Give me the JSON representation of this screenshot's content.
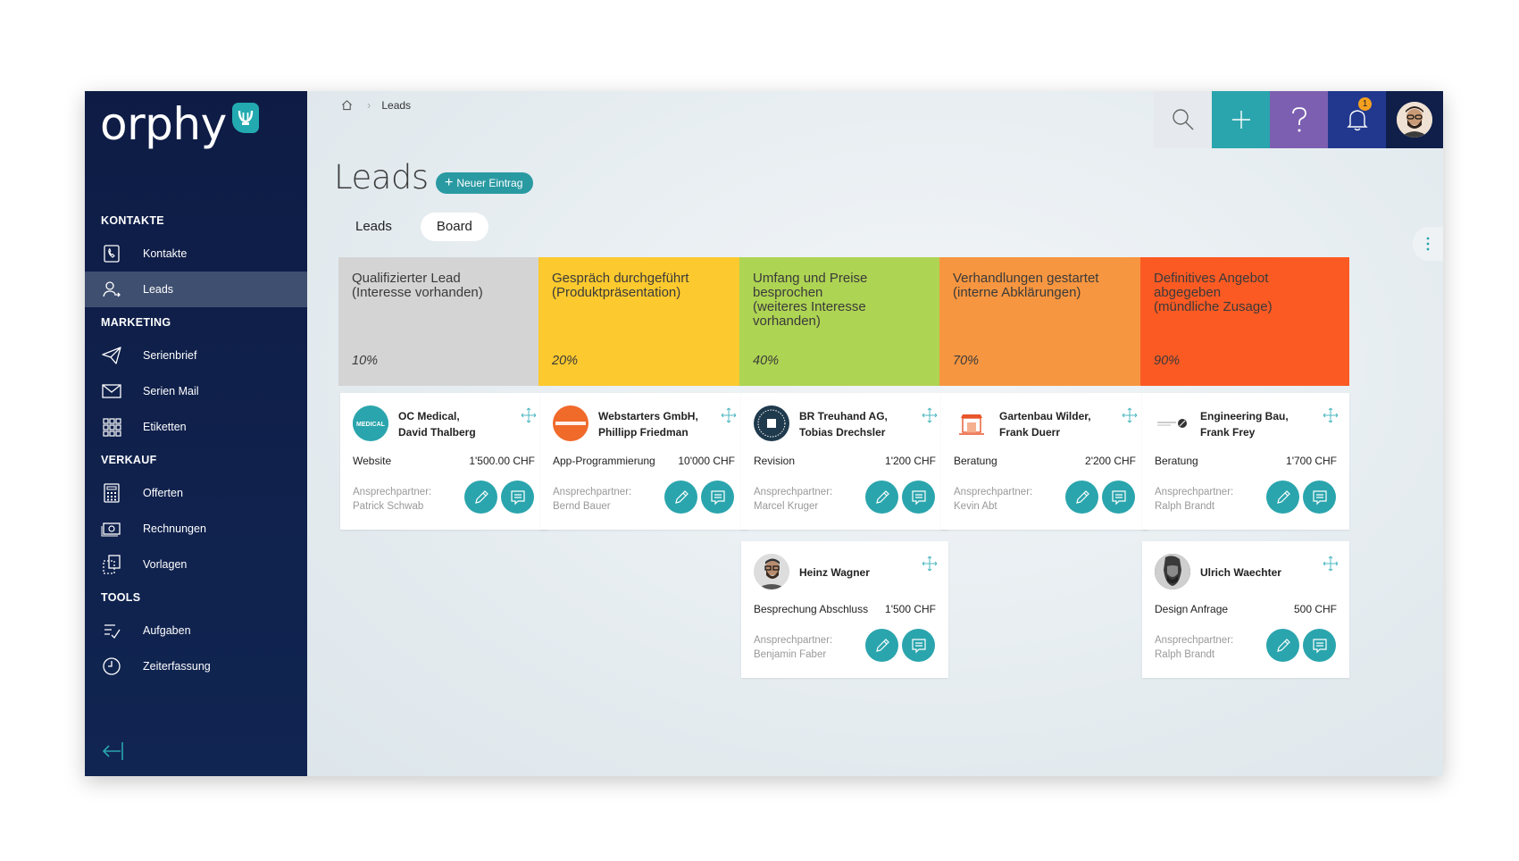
{
  "app": {
    "logo_text": "orphy"
  },
  "sidebar": {
    "sections": [
      {
        "label": "KONTAKTE",
        "items": [
          {
            "label": "Kontakte",
            "icon": "phone-book-icon",
            "active": false
          },
          {
            "label": "Leads",
            "icon": "user-lead-icon",
            "active": true
          }
        ]
      },
      {
        "label": "MARKETING",
        "items": [
          {
            "label": "Serienbrief",
            "icon": "paper-plane-icon",
            "active": false
          },
          {
            "label": "Serien Mail",
            "icon": "envelope-icon",
            "active": false
          },
          {
            "label": "Etiketten",
            "icon": "grid-labels-icon",
            "active": false
          }
        ]
      },
      {
        "label": "VERKAUF",
        "items": [
          {
            "label": "Offerten",
            "icon": "calculator-icon",
            "active": false
          },
          {
            "label": "Rechnungen",
            "icon": "banknote-icon",
            "active": false
          },
          {
            "label": "Vorlagen",
            "icon": "templates-icon",
            "active": false
          }
        ]
      },
      {
        "label": "TOOLS",
        "items": [
          {
            "label": "Aufgaben",
            "icon": "task-check-icon",
            "active": false
          },
          {
            "label": "Zeiterfassung",
            "icon": "clock-icon",
            "active": false
          }
        ]
      }
    ]
  },
  "breadcrumb": {
    "home_icon": "home-icon",
    "current": "Leads"
  },
  "topbar": {
    "notification_count": "1",
    "colors": {
      "search": "#e6eaee",
      "add": "#2aa5ad",
      "help": "#7c5fb1",
      "bell": "#22388f"
    }
  },
  "page": {
    "title": "Leads",
    "new_button": "Neuer Eintrag",
    "tabs": [
      {
        "label": "Leads",
        "active": false
      },
      {
        "label": "Board",
        "active": true
      }
    ]
  },
  "columns": [
    {
      "title": "Qualifizierter Lead\n(Interesse vorhanden)",
      "percent": "10%",
      "color": "#d4d4d4",
      "cards": [
        {
          "company": "OC Medical,\nDavid Thalberg",
          "logo": "medical",
          "service": "Website",
          "amount": "1'500.00 CHF",
          "contact_label": "Ansprechpartner:",
          "contact": "Patrick Schwab"
        }
      ]
    },
    {
      "title": "Gespräch durchgeführt\n(Produktpräsentation)",
      "percent": "20%",
      "color": "#fcc92e",
      "cards": [
        {
          "company": "Webstarters GmbH,\nPhillipp Friedman",
          "logo": "webstarters",
          "service": "App-Programmierung",
          "amount": "10'000 CHF",
          "contact_label": "Ansprechpartner:",
          "contact": "Bernd Bauer"
        }
      ]
    },
    {
      "title": "Umfang und Preise\nbesprochen\n(weiteres Interesse\nvorhanden)",
      "percent": "40%",
      "color": "#aed453",
      "cards": [
        {
          "company": "BR Treuhand AG,\nTobias Drechsler",
          "logo": "treuhand",
          "service": "Revision",
          "amount": "1'200 CHF",
          "contact_label": "Ansprechpartner:",
          "contact": "Marcel Kruger"
        },
        {
          "company": "Heinz Wagner",
          "logo": "person-beard",
          "service": "Besprechung Abschluss",
          "amount": "1'500 CHF",
          "contact_label": "Ansprechpartner:",
          "contact": "Benjamin Faber"
        }
      ]
    },
    {
      "title": "Verhandlungen gestartet\n(interne Abklärungen)",
      "percent": "70%",
      "color": "#f79640",
      "cards": [
        {
          "company": "Gartenbau Wilder,\nFrank Duerr",
          "logo": "gartenbau",
          "service": "Beratung",
          "amount": "2'200 CHF",
          "contact_label": "Ansprechpartner:",
          "contact": "Kevin Abt"
        }
      ]
    },
    {
      "title": "Definitives Angebot\nabgegeben\n(mündliche Zusage)",
      "percent": "90%",
      "color": "#fc5a23",
      "cards": [
        {
          "company": "Engineering Bau,\nFrank Frey",
          "logo": "engineering",
          "service": "Beratung",
          "amount": "1'700 CHF",
          "contact_label": "Ansprechpartner:",
          "contact": "Ralph Brandt"
        },
        {
          "company": "Ulrich Waechter",
          "logo": "person-bw",
          "service": "Design Anfrage",
          "amount": "500 CHF",
          "contact_label": "Ansprechpartner:",
          "contact": "Ralph Brandt"
        }
      ]
    }
  ]
}
